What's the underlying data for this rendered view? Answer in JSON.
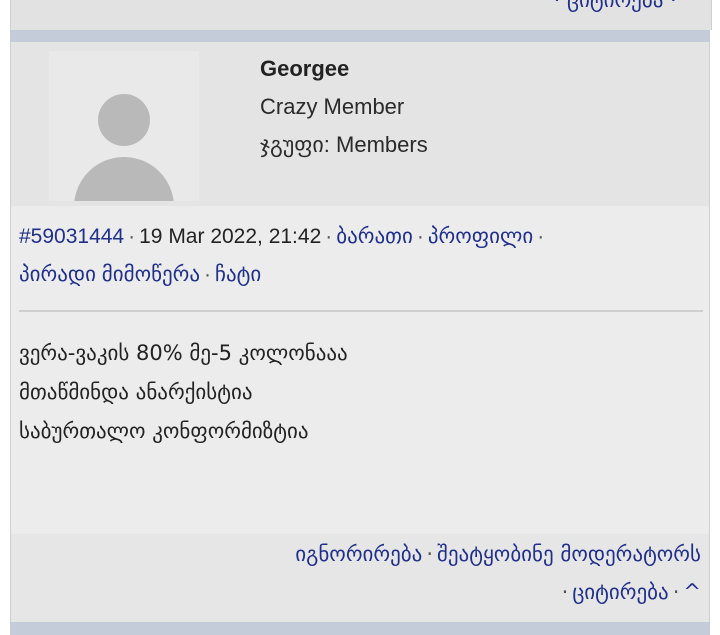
{
  "previous_post": {
    "quote_link": "· ციტირება · ^"
  },
  "post": {
    "author": {
      "name": "Georgee",
      "rank": "Crazy Member",
      "group_label": "ჯგუფი:",
      "group_value": "Members"
    },
    "meta": {
      "id": "#59031444",
      "date": "19 Mar 2022, 21:42",
      "links": [
        "ბარათი",
        "პროფილი",
        "პირადი მიმოწერა",
        "ჩატი"
      ]
    },
    "content": [
      "ვერა-ვაკის 80% მე-5 კოლონააა",
      "მთაწმინდა ანარქისტია",
      "საბურთალო კონფორმიზტია"
    ],
    "footer": {
      "ignore": "იგნორირება",
      "report": "შეატყობინე მოდერატორს",
      "quote": "ციტირება",
      "top": "^"
    }
  }
}
